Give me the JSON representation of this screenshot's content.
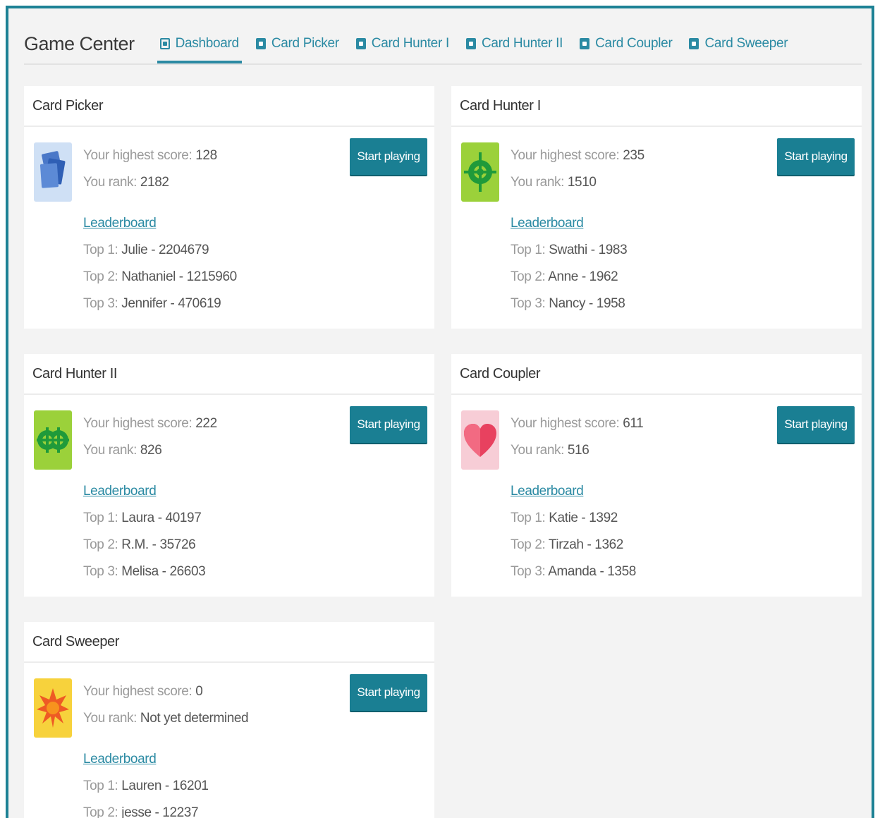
{
  "app": {
    "title": "Game Center"
  },
  "nav": {
    "tabs": [
      {
        "label": "Dashboard",
        "icon": "dashboard-icon"
      },
      {
        "label": "Card Picker",
        "icon": "card-icon"
      },
      {
        "label": "Card Hunter I",
        "icon": "card-icon"
      },
      {
        "label": "Card Hunter II",
        "icon": "card-icon"
      },
      {
        "label": "Card Coupler",
        "icon": "card-icon"
      },
      {
        "label": "Card Sweeper",
        "icon": "card-icon"
      }
    ],
    "active_tab": "Dashboard"
  },
  "labels": {
    "highest_score": "Your highest score:",
    "rank": "You rank:",
    "leaderboard": "Leaderboard",
    "start_button": "Start playing"
  },
  "games": [
    {
      "name": "Card Picker",
      "icon": "cards-icon",
      "highest_score": "128",
      "rank": "2182",
      "top": [
        {
          "prefix": "Top 1:",
          "entry": "Julie - 2204679"
        },
        {
          "prefix": "Top 2:",
          "entry": "Nathaniel - 1215960"
        },
        {
          "prefix": "Top 3:",
          "entry": "Jennifer - 470619"
        }
      ]
    },
    {
      "name": "Card Hunter I",
      "icon": "crosshair-icon",
      "highest_score": "235",
      "rank": "1510",
      "top": [
        {
          "prefix": "Top 1:",
          "entry": "Swathi - 1983"
        },
        {
          "prefix": "Top 2:",
          "entry": "Anne - 1962"
        },
        {
          "prefix": "Top 3:",
          "entry": "Nancy - 1958"
        }
      ]
    },
    {
      "name": "Card Hunter II",
      "icon": "double-crosshair-icon",
      "highest_score": "222",
      "rank": "826",
      "top": [
        {
          "prefix": "Top 1:",
          "entry": "Laura - 40197"
        },
        {
          "prefix": "Top 2:",
          "entry": "R.M. - 35726"
        },
        {
          "prefix": "Top 3:",
          "entry": "Melisa - 26603"
        }
      ]
    },
    {
      "name": "Card Coupler",
      "icon": "heart-icon",
      "highest_score": "611",
      "rank": "516",
      "top": [
        {
          "prefix": "Top 1:",
          "entry": "Katie - 1392"
        },
        {
          "prefix": "Top 2:",
          "entry": "Tirzah - 1362"
        },
        {
          "prefix": "Top 3:",
          "entry": "Amanda - 1358"
        }
      ]
    },
    {
      "name": "Card Sweeper",
      "icon": "starburst-icon",
      "highest_score": "0",
      "rank": "Not yet determined",
      "top": [
        {
          "prefix": "Top 1:",
          "entry": "Lauren - 16201"
        },
        {
          "prefix": "Top 2:",
          "entry": "jesse - 12237"
        }
      ]
    }
  ],
  "colors": {
    "frame_border": "#1d8295",
    "accent": "#2b8aa3",
    "button": "#1a7f93",
    "background": "#f3f3f3",
    "card": "#ffffff"
  }
}
